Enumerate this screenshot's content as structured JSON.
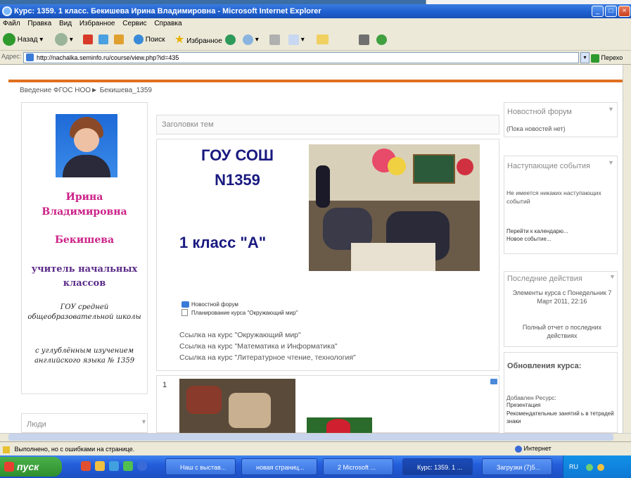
{
  "window": {
    "title": "Курс: 1359. 1 класс. Бекишева Ирина Владимировна - Microsoft Internet Explorer"
  },
  "menu": [
    "Файл",
    "Правка",
    "Вид",
    "Избранное",
    "Сервис",
    "Справка"
  ],
  "toolbar": {
    "back": "Назад",
    "search": "Поиск",
    "favorites": "Избранное"
  },
  "address": {
    "label": "Адрес:",
    "url": "http://nachalka.seminfo.ru/course/view.php?id=435",
    "go": "Перехо"
  },
  "breadcrumb": "Введение ФГОС НОО► Бекишева_1359",
  "teacher": {
    "first_name": "Ирина",
    "patronymic": "Владимировна",
    "surname": "Бекишева",
    "role": "учитель начальных классов",
    "school": "ГОУ средней общеобразовательной школы",
    "school_detail": "с углублённым изучением английского языка № 1359"
  },
  "left_block": {
    "people": "Люди"
  },
  "center": {
    "topics_header": "Заголовки тем",
    "school_title_1": "ГОУ СОШ",
    "school_title_2": "N1359",
    "class_title": "1 класс \"А\"",
    "resources": [
      "Новостной форум",
      "Планирование курса \"Окружающий мир\""
    ],
    "course_links": [
      "Ссылка на курс \"Окружающий мир\"",
      "Ссылка на курс \"Математика и Информатика\"",
      "Ссылка на курс \"Литературное чтение, технология\""
    ],
    "section_number": "1"
  },
  "right": {
    "news_forum": {
      "title": "Новостной форум",
      "body": "(Пока новостей нет)"
    },
    "upcoming": {
      "title": "Наступающие события",
      "body": "Не имеется никаких наступающих событий",
      "link1": "Перейти к календарю...",
      "link2": "Новое событие..."
    },
    "recent": {
      "title": "Последние действия",
      "body": "Элементы курса с Понедельник 7 Март 2011, 22:16",
      "report": "Полный отчет о последних действиях"
    },
    "updates": {
      "title": "Обновления курса:",
      "added": "Добавлен Ресурс:",
      "item1": "Презентация",
      "item2": "Рекомендательные занятий ь в тетрадей знаки"
    }
  },
  "status": {
    "text": "Выполнено, но с ошибками на странице.",
    "zone": "Интернет"
  },
  "taskbar": {
    "start": "пуск",
    "tasks": [
      "Наш с выстав...",
      "новая страниц...",
      "2 Microsoft ...",
      "Курс: 1359. 1 ...",
      "Загрузки (7)5..."
    ],
    "tray_text": "RU"
  }
}
